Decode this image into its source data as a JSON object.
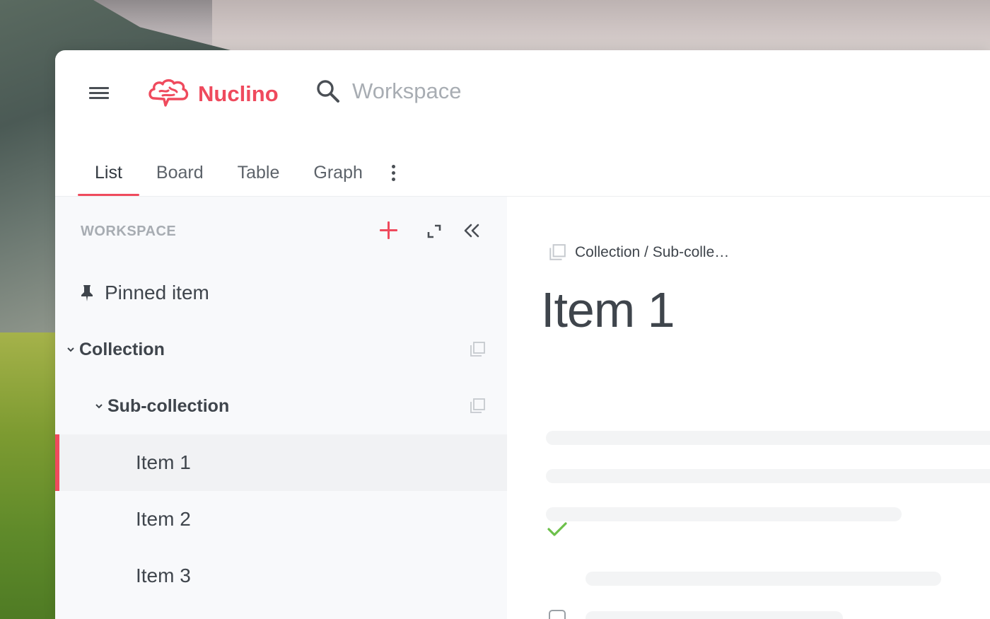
{
  "app": {
    "logo_text": "Nuclino",
    "search_placeholder": "Workspace"
  },
  "tabs": [
    {
      "label": "List",
      "active": true
    },
    {
      "label": "Board",
      "active": false
    },
    {
      "label": "Table",
      "active": false
    },
    {
      "label": "Graph",
      "active": false
    }
  ],
  "sidebar": {
    "header": "WORKSPACE",
    "items": [
      {
        "label": "Pinned item",
        "type": "pinned"
      },
      {
        "label": "Collection",
        "type": "collection",
        "expanded": true
      },
      {
        "label": "Sub-collection",
        "type": "collection",
        "expanded": true
      },
      {
        "label": "Item 1",
        "type": "item",
        "selected": true
      },
      {
        "label": "Item 2",
        "type": "item"
      },
      {
        "label": "Item 3",
        "type": "item"
      }
    ]
  },
  "content": {
    "breadcrumb": "Collection / Sub-colle…",
    "title": "Item 1"
  },
  "colors": {
    "accent": "#ef4a5d",
    "check": "#6cc04a",
    "text": "#3f454c"
  },
  "icons": [
    "menu-icon",
    "brain-logo-icon",
    "search-icon",
    "more-vertical-icon",
    "plus-icon",
    "expand-icon",
    "collapse-left-icon",
    "pin-icon",
    "chevron-down-icon",
    "copy-icon",
    "checkmark-icon",
    "checkbox-icon"
  ]
}
